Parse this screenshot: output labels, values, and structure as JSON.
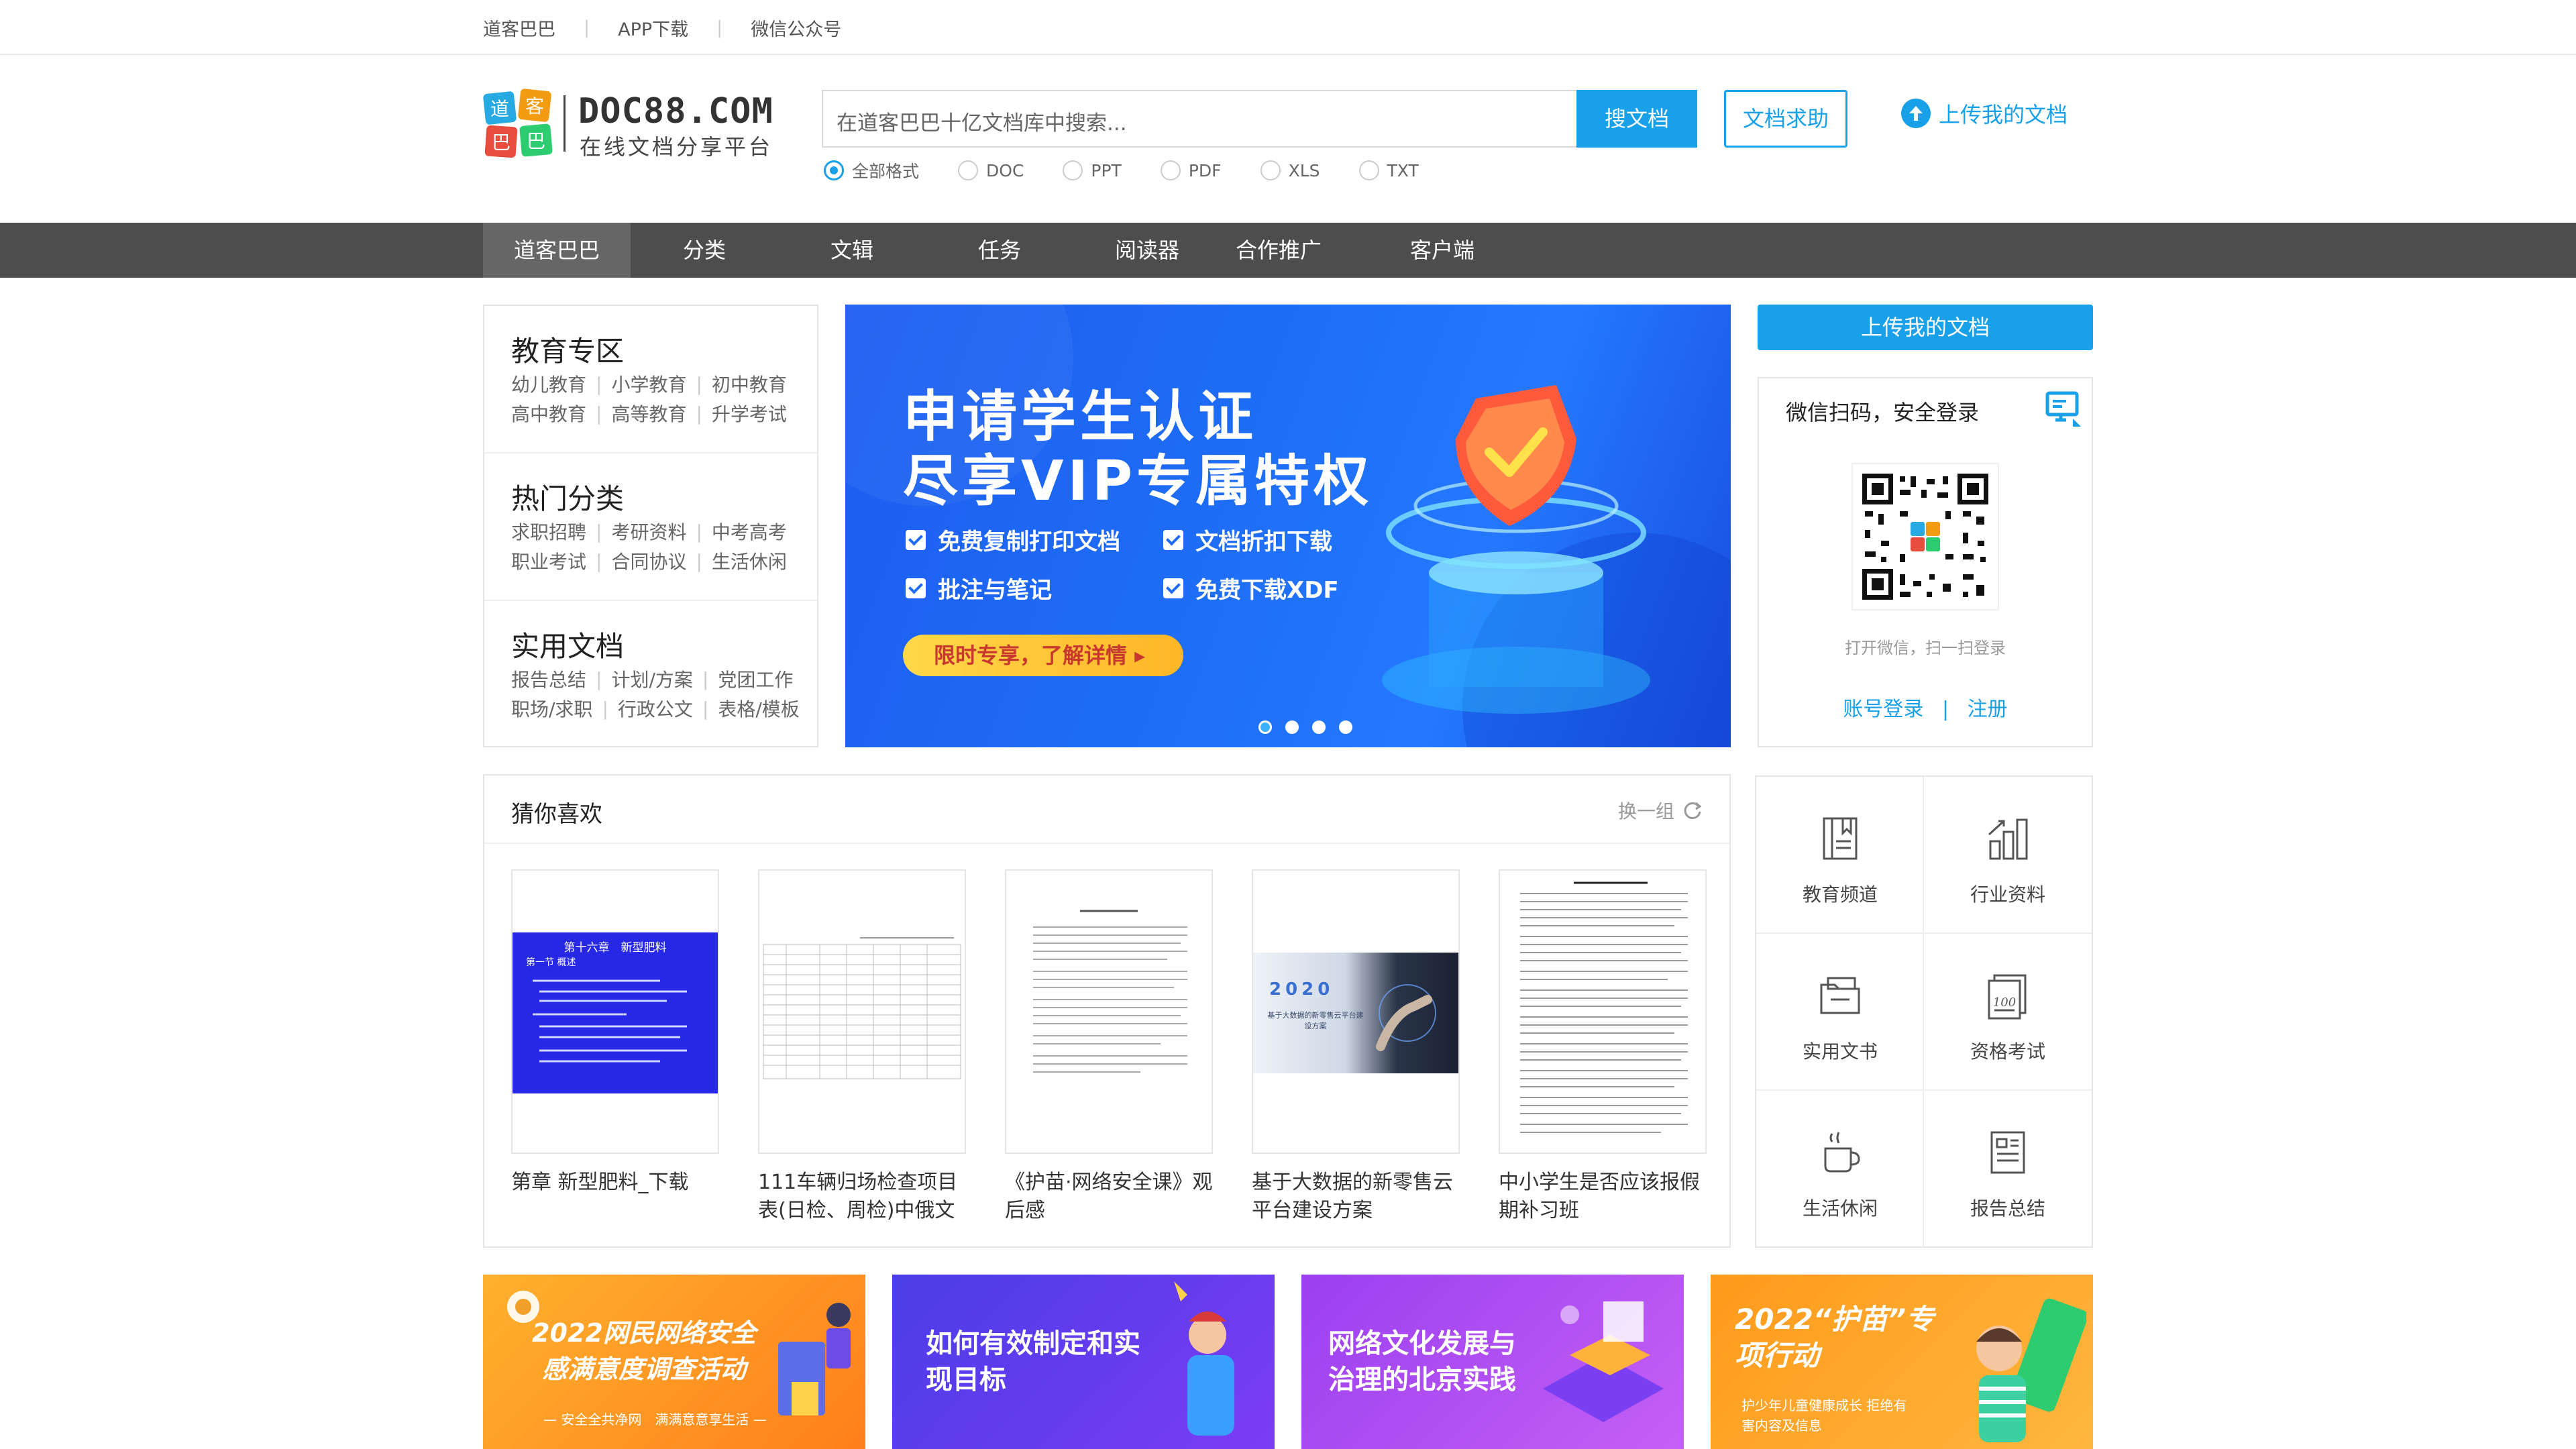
{
  "topbar": {
    "links": [
      "道客巴巴",
      "APP下载",
      "微信公众号"
    ]
  },
  "header": {
    "logo_domain": "DOC88.COM",
    "logo_slogan": "在线文档分享平台",
    "logo_chars": "道客巴巴",
    "search_placeholder": "在道客巴巴十亿文档库中搜索...",
    "search_button": "搜文档",
    "help_button": "文档求助",
    "upload_link": "上传我的文档",
    "formats": [
      "全部格式",
      "DOC",
      "PPT",
      "PDF",
      "XLS",
      "TXT"
    ],
    "selected_format": "全部格式"
  },
  "nav": {
    "items": [
      "道客巴巴",
      "分类",
      "文辑",
      "任务",
      "阅读器",
      "合作推广",
      "客户端"
    ],
    "active": "道客巴巴"
  },
  "categories": [
    {
      "title": "教育专区",
      "rows": [
        [
          "幼儿教育",
          "小学教育",
          "初中教育"
        ],
        [
          "高中教育",
          "高等教育",
          "升学考试"
        ]
      ]
    },
    {
      "title": "热门分类",
      "rows": [
        [
          "求职招聘",
          "考研资料",
          "中考高考"
        ],
        [
          "职业考试",
          "合同协议",
          "生活休闲"
        ]
      ]
    },
    {
      "title": "实用文档",
      "rows": [
        [
          "报告总结",
          "计划/方案",
          "党团工作"
        ],
        [
          "职场/求职",
          "行政公文",
          "表格/模板"
        ]
      ]
    }
  ],
  "banner": {
    "title_line1": "申请学生认证",
    "title_line2": "尽享VIP专属特权",
    "perks": [
      "免费复制打印文档",
      "文档折扣下载",
      "批注与笔记",
      "免费下载XDF"
    ],
    "cta": "限时专享，了解详情 ▸",
    "slides": 4,
    "active_slide": 1
  },
  "login": {
    "upload_button": "上传我的文档",
    "title": "微信扫码，安全登录",
    "hint": "打开微信，扫一扫登录",
    "account_login": "账号登录",
    "separator": "|",
    "register": "注册"
  },
  "guess": {
    "title": "猜你喜欢",
    "swap": "换一组",
    "docs": [
      {
        "name": "第章 新型肥料_下载",
        "thumb_heading": "第十六章　新型肥料",
        "thumb_sub": "第一节 概述"
      },
      {
        "name": "111车辆归场检查项目表(日检、周检)中俄文"
      },
      {
        "name": "《护苗·网络安全课》观后感"
      },
      {
        "name": "基于大数据的新零售云平台建设方案",
        "thumb_heading": "2020",
        "thumb_sub": "基于大数据的新零售云平台建设方案"
      },
      {
        "name": "中小学生是否应该报假期补习班"
      }
    ]
  },
  "channels": [
    "教育频道",
    "行业资料",
    "实用文书",
    "资格考试",
    "生活休闲",
    "报告总结"
  ],
  "promos": [
    {
      "title": "2022网民网络安全感满意度调查活动",
      "sub": "— 安全全共净网　满满意意享生活 —",
      "colors": [
        "#ffa92e",
        "#ff7a1a"
      ]
    },
    {
      "title": "如何有效制定和实现目标",
      "colors": [
        "#5a3ff0",
        "#7b3ef7"
      ]
    },
    {
      "title": "网络文化发展与治理的北京实践",
      "colors": [
        "#a43ef0",
        "#c55bf5"
      ]
    },
    {
      "title": "2022“护苗”专项行动",
      "sub": "护少年儿童健康成长 拒绝有害内容及信息",
      "colors": [
        "#ff9f1c",
        "#ffb53a"
      ]
    }
  ],
  "colors": {
    "accent": "#18a0e9",
    "nav_bg": "#4d4d4d",
    "banner": "#1e6cf6"
  }
}
